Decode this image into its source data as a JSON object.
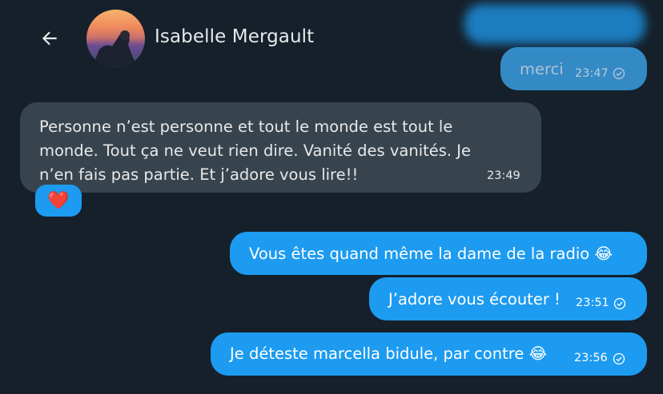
{
  "header": {
    "contact_name": "Isabelle Mergault"
  },
  "messages": {
    "m1": {
      "text": "merci",
      "time": "23:47"
    },
    "m2": {
      "line1": "Personne n’est personne et tout le monde est tout le",
      "line2": "monde. Tout ça ne veut rien dire. Vanité des vanités. Je",
      "line3": "n’en fais pas partie. Et j’adore vous lire!!",
      "time": "23:49",
      "reaction": "❤️"
    },
    "m3": {
      "text": "Vous êtes quand même la dame de la radio 😂"
    },
    "m4": {
      "text": "J’adore vous écouter !",
      "time": "23:51"
    },
    "m5": {
      "text": "Je déteste marcella bidule, par contre 😂",
      "time": "23:56"
    }
  },
  "colors": {
    "background": "#15202b",
    "sent_bubble": "#1d9bf0",
    "received_bubble": "#38444d",
    "text": "#e7e9ea"
  },
  "icons": [
    "back-arrow-icon",
    "read-check-icon",
    "heart-reaction-icon"
  ]
}
